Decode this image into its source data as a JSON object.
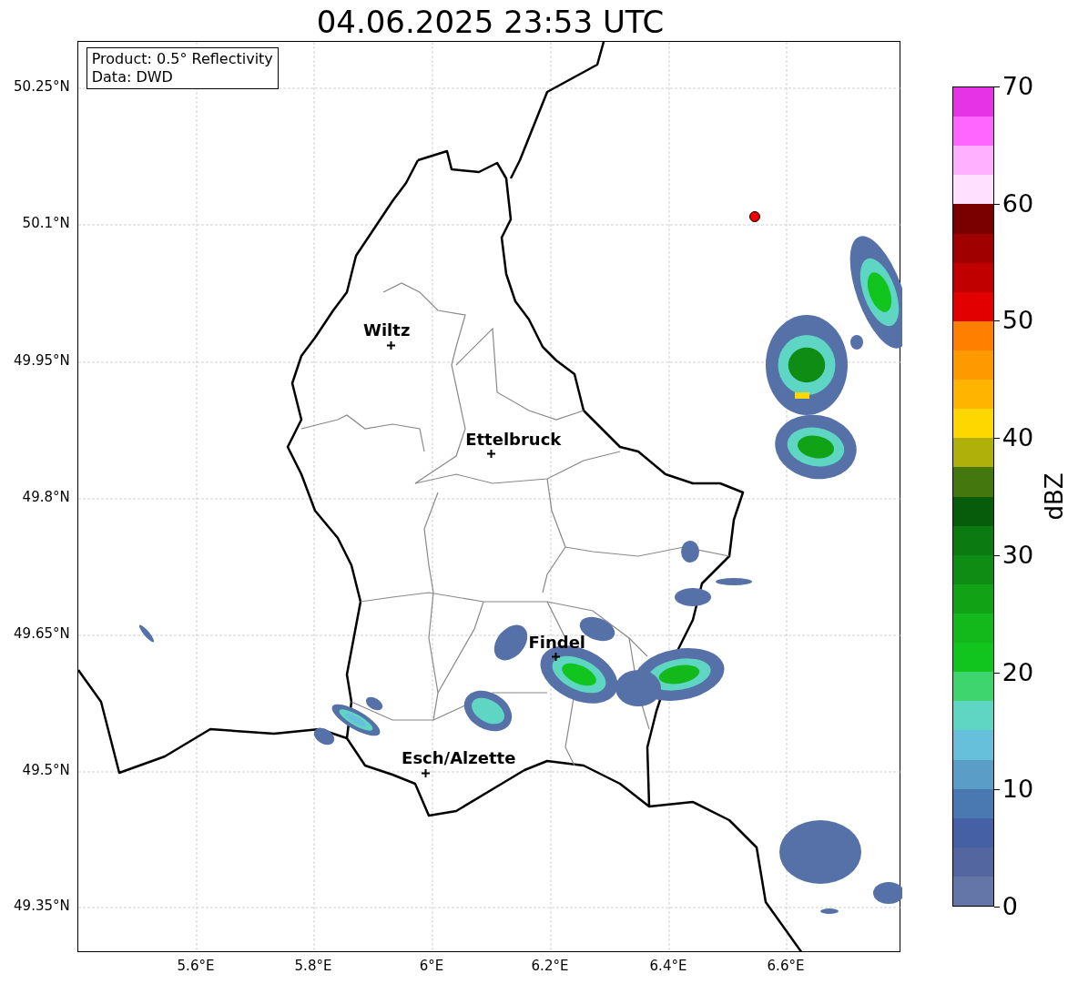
{
  "title": "04.06.2025 23:53 UTC",
  "info_box": [
    "Product: 0.5° Reflectivity",
    "Data: DWD"
  ],
  "lat_ticks": [
    "50.25°N",
    "50.1°N",
    "49.95°N",
    "49.8°N",
    "49.65°N",
    "49.5°N",
    "49.35°N"
  ],
  "lon_ticks": [
    "5.6°E",
    "5.8°E",
    "6°E",
    "6.2°E",
    "6.4°E",
    "6.6°E"
  ],
  "cities": [
    {
      "name": "Wiltz"
    },
    {
      "name": "Ettelbruck"
    },
    {
      "name": "Findel"
    },
    {
      "name": "Esch/Alzette"
    }
  ],
  "colorbar": {
    "label": "dBZ",
    "ticks": [
      "70",
      "60",
      "50",
      "40",
      "30",
      "20",
      "10",
      "0"
    ],
    "bins": [
      {
        "color": "#e633e6"
      },
      {
        "color": "#ff66ff"
      },
      {
        "color": "#ffb0ff"
      },
      {
        "color": "#ffe0ff"
      },
      {
        "color": "#7a0000"
      },
      {
        "color": "#a00000"
      },
      {
        "color": "#c00000"
      },
      {
        "color": "#e20000"
      },
      {
        "color": "#ff7f00"
      },
      {
        "color": "#ff9900"
      },
      {
        "color": "#ffb400"
      },
      {
        "color": "#ffd700"
      },
      {
        "color": "#b0b00a"
      },
      {
        "color": "#44770e"
      },
      {
        "color": "#065c0a"
      },
      {
        "color": "#0b7a10"
      },
      {
        "color": "#0f8c14"
      },
      {
        "color": "#11a216"
      },
      {
        "color": "#13b81b"
      },
      {
        "color": "#12c41e"
      },
      {
        "color": "#3ed46e"
      },
      {
        "color": "#5fd6c4"
      },
      {
        "color": "#66c0dc"
      },
      {
        "color": "#5a9ec8"
      },
      {
        "color": "#4a78b0"
      },
      {
        "color": "#4660a6"
      },
      {
        "color": "#5466a0"
      },
      {
        "color": "#6475a8"
      }
    ]
  }
}
